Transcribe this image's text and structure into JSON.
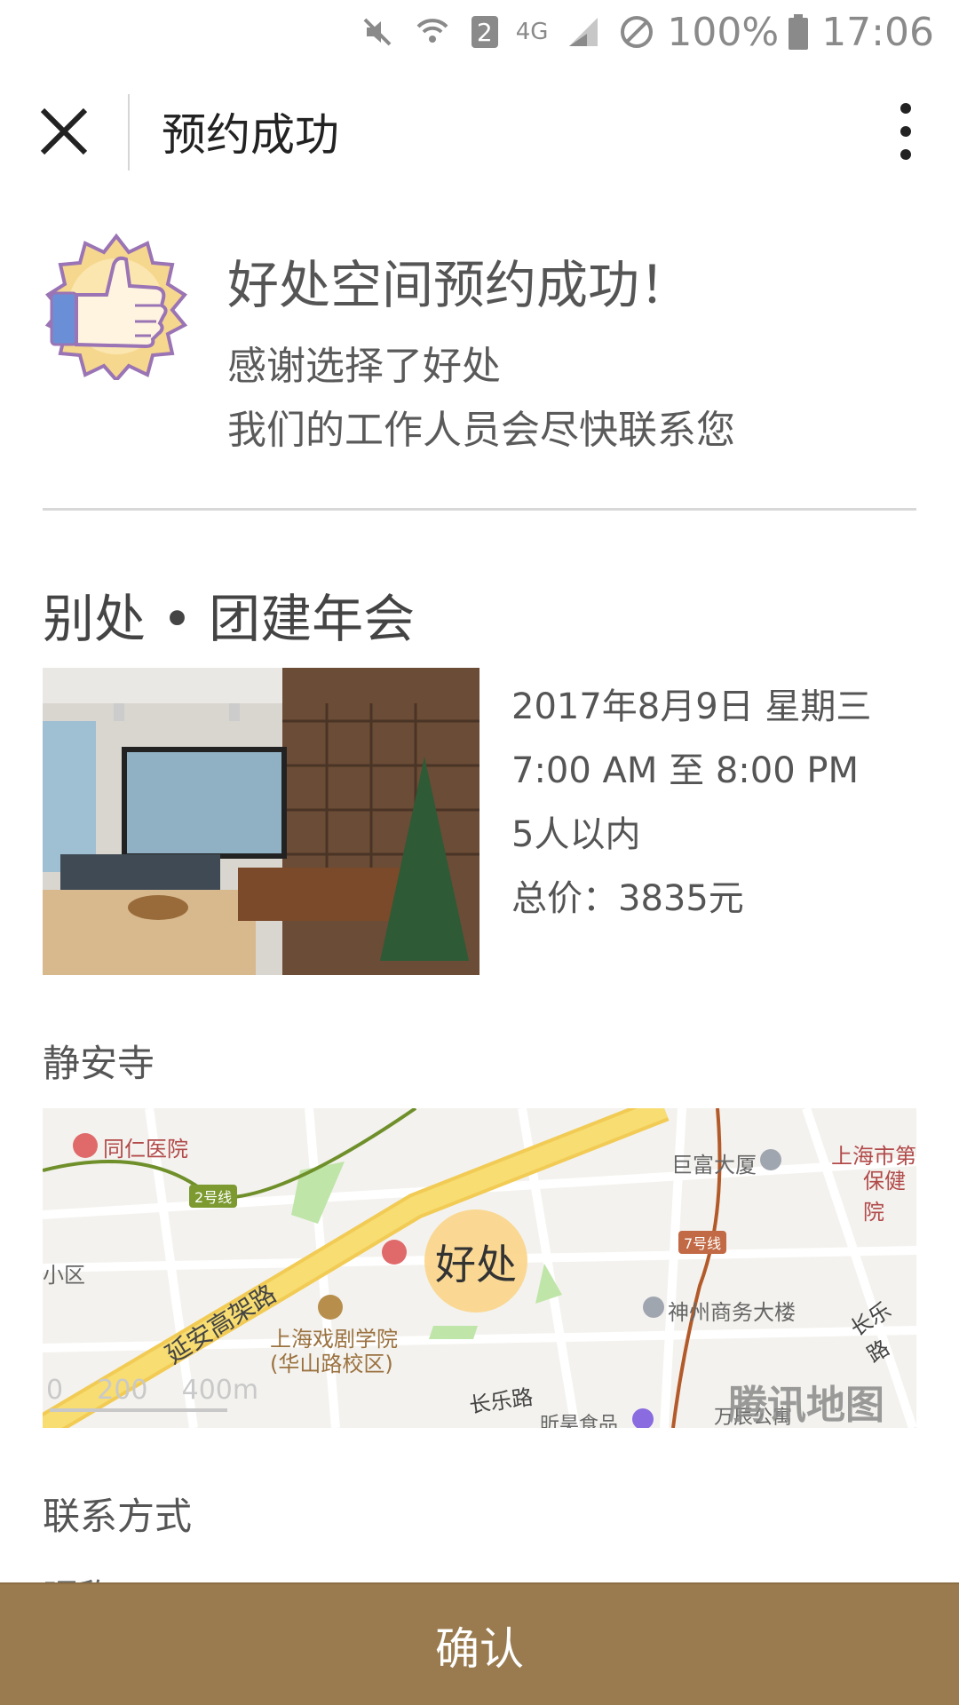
{
  "status_bar": {
    "battery_text": "100%",
    "time": "17:06",
    "sim_slot": "2",
    "network": "4G",
    "icons": [
      "mute-icon",
      "wifi-icon",
      "sim-icon",
      "signal-icon",
      "do-not-disturb-icon",
      "battery-icon"
    ]
  },
  "topbar": {
    "title": "预约成功",
    "close_icon": "close-icon",
    "more_icon": "more-vertical-icon"
  },
  "success": {
    "icon": "thumbs-up-badge-icon",
    "title": "好处空间预约成功！",
    "line1": "感谢选择了好处",
    "line2": "我们的工作人员会尽快联系您"
  },
  "event": {
    "title": "别处 • 团建年会",
    "date": "2017年8月9日 星期三",
    "time": "7:00 AM 至 8:00 PM",
    "capacity": "5人以内",
    "price": "总价：3835元"
  },
  "location": {
    "label": "静安寺",
    "map": {
      "marker_text": "好处",
      "labels": {
        "hospital": "同仁医院",
        "building1": "巨富大厦",
        "building2": "上海市第",
        "building2b": "保健院",
        "line2": "2号线",
        "line7": "7号线",
        "road1": "延安高架路",
        "school1": "上海戏剧学院",
        "school2": "(华山路校区)",
        "office": "神州商务大楼",
        "road2": "长乐路",
        "road3": "长乐路",
        "food": "昕昊食品",
        "apartment": "万辰公寓",
        "left_label": "小区",
        "scale": "0    200    400m",
        "brand": "腾讯地图"
      }
    }
  },
  "contact": {
    "label": "联系方式",
    "name_label": "昵称"
  },
  "footer": {
    "confirm_label": "确认"
  },
  "colors": {
    "accent": "#9a7b4f",
    "map_road_major": "#f7dd72",
    "map_line7": "#b35a2a",
    "map_line2": "#6f8f2a"
  }
}
